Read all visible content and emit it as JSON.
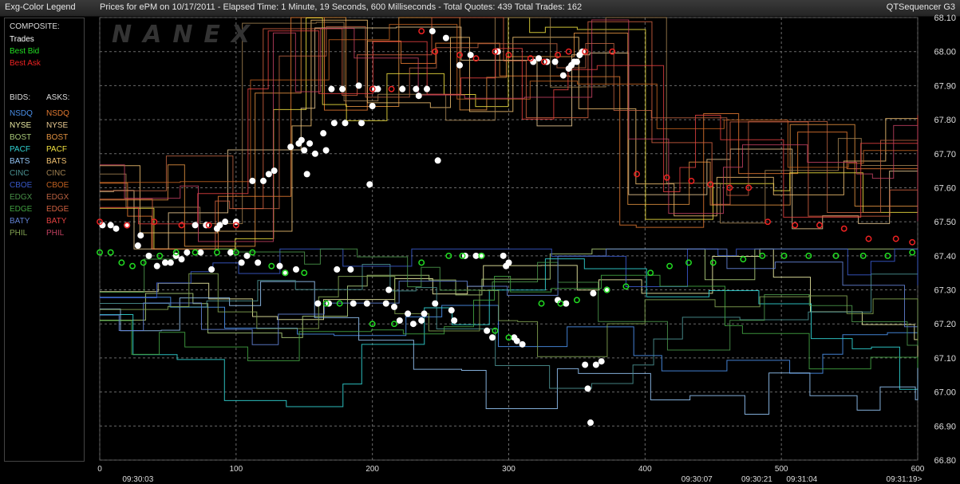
{
  "window": {
    "legend_title": "Exg-Color Legend",
    "chart_title": "Prices for  ePM  on  10/17/2011   -  Elapsed Time: 1 Minute, 19 Seconds, 600 Milliseconds   -  Total Quotes: 439  Total Trades: 162",
    "app_name": "QTSequencer G3"
  },
  "watermark": "NANEX",
  "legend": {
    "composite_header": "COMPOSITE:",
    "composite": [
      {
        "label": "Trades",
        "color": "#ffffff"
      },
      {
        "label": "Best Bid",
        "color": "#22dd22"
      },
      {
        "label": "Best Ask",
        "color": "#ee2222"
      }
    ],
    "bids_header": "BIDS:",
    "asks_header": "ASKS:",
    "exchanges": [
      {
        "name": "NSDQ",
        "bid_color": "#4a8fe8",
        "ask_color": "#e07830"
      },
      {
        "name": "NYSE",
        "bid_color": "#e8e8a0",
        "ask_color": "#e8c890"
      },
      {
        "name": "BOST",
        "bid_color": "#a8c878",
        "ask_color": "#e09040"
      },
      {
        "name": "PACF",
        "bid_color": "#30d0d0",
        "ask_color": "#f0e040"
      },
      {
        "name": "BATS",
        "bid_color": "#90c0f0",
        "ask_color": "#f0c070"
      },
      {
        "name": "CINC",
        "bid_color": "#4a9090",
        "ask_color": "#a08050"
      },
      {
        "name": "CBOE",
        "bid_color": "#3858c8",
        "ask_color": "#c06020"
      },
      {
        "name": "EDGX",
        "bid_color": "#489048",
        "ask_color": "#b86040"
      },
      {
        "name": "EDGE",
        "bid_color": "#40a040",
        "ask_color": "#d06040"
      },
      {
        "name": "BATY",
        "bid_color": "#6080d0",
        "ask_color": "#e04040"
      },
      {
        "name": "PHIL",
        "bid_color": "#80a050",
        "ask_color": "#c04060"
      }
    ]
  },
  "chart_data": {
    "type": "scatter",
    "title": "Prices for  ePM  on  10/17/2011",
    "x_range": [
      0,
      600
    ],
    "y_range": [
      66.8,
      68.1
    ],
    "x_ticks": [
      0,
      100,
      200,
      300,
      400,
      500,
      600
    ],
    "y_ticks": [
      "68.10",
      "68.00",
      "67.90",
      "67.80",
      "67.70",
      "67.60",
      "67.50",
      "67.40",
      "67.30",
      "67.20",
      "67.10",
      "67.00",
      "66.90",
      "66.80"
    ],
    "time_labels": [
      {
        "x": 28,
        "label": "09:30:03"
      },
      {
        "x": 438,
        "label": "09:30:07"
      },
      {
        "x": 482,
        "label": "09:30:21"
      },
      {
        "x": 515,
        "label": "09:31:04"
      },
      {
        "x": 590,
        "label": "09:31:19>"
      }
    ],
    "grid": true,
    "series": [
      {
        "name": "Trades",
        "color": "#ffffff",
        "marker": "dot",
        "points": [
          [
            2,
            67.49
          ],
          [
            8,
            67.49
          ],
          [
            12,
            67.48
          ],
          [
            20,
            67.49
          ],
          [
            28,
            67.43
          ],
          [
            30,
            67.46
          ],
          [
            36,
            67.4
          ],
          [
            42,
            67.37
          ],
          [
            48,
            67.38
          ],
          [
            52,
            67.38
          ],
          [
            56,
            67.4
          ],
          [
            60,
            67.39
          ],
          [
            64,
            67.41
          ],
          [
            70,
            67.49
          ],
          [
            74,
            67.41
          ],
          [
            78,
            67.49
          ],
          [
            82,
            67.36
          ],
          [
            86,
            67.48
          ],
          [
            88,
            67.49
          ],
          [
            92,
            67.5
          ],
          [
            96,
            67.41
          ],
          [
            100,
            67.5
          ],
          [
            104,
            67.38
          ],
          [
            108,
            67.4
          ],
          [
            112,
            67.62
          ],
          [
            116,
            67.38
          ],
          [
            120,
            67.62
          ],
          [
            124,
            67.64
          ],
          [
            128,
            67.65
          ],
          [
            132,
            67.37
          ],
          [
            136,
            67.35
          ],
          [
            140,
            67.72
          ],
          [
            144,
            67.36
          ],
          [
            146,
            67.73
          ],
          [
            148,
            67.74
          ],
          [
            150,
            67.71
          ],
          [
            152,
            67.64
          ],
          [
            154,
            67.73
          ],
          [
            158,
            67.7
          ],
          [
            160,
            67.26
          ],
          [
            164,
            67.76
          ],
          [
            166,
            67.71
          ],
          [
            168,
            67.26
          ],
          [
            170,
            67.89
          ],
          [
            172,
            67.79
          ],
          [
            174,
            67.36
          ],
          [
            178,
            67.89
          ],
          [
            180,
            67.79
          ],
          [
            184,
            67.36
          ],
          [
            186,
            67.26
          ],
          [
            190,
            67.9
          ],
          [
            192,
            67.79
          ],
          [
            196,
            67.26
          ],
          [
            198,
            67.61
          ],
          [
            200,
            67.84
          ],
          [
            202,
            67.89
          ],
          [
            204,
            67.89
          ],
          [
            210,
            67.26
          ],
          [
            212,
            67.3
          ],
          [
            216,
            67.25
          ],
          [
            220,
            67.21
          ],
          [
            222,
            67.89
          ],
          [
            226,
            67.23
          ],
          [
            230,
            67.2
          ],
          [
            232,
            67.89
          ],
          [
            234,
            67.87
          ],
          [
            236,
            67.21
          ],
          [
            238,
            67.23
          ],
          [
            240,
            67.89
          ],
          [
            244,
            68.06
          ],
          [
            246,
            67.26
          ],
          [
            248,
            67.68
          ],
          [
            254,
            68.04
          ],
          [
            258,
            67.24
          ],
          [
            260,
            67.21
          ],
          [
            264,
            67.96
          ],
          [
            268,
            67.4
          ],
          [
            272,
            67.99
          ],
          [
            276,
            67.4
          ],
          [
            280,
            67.4
          ],
          [
            284,
            67.18
          ],
          [
            288,
            67.16
          ],
          [
            292,
            68.0
          ],
          [
            296,
            67.4
          ],
          [
            298,
            67.37
          ],
          [
            300,
            67.38
          ],
          [
            304,
            67.16
          ],
          [
            306,
            67.15
          ],
          [
            310,
            67.14
          ],
          [
            318,
            67.97
          ],
          [
            322,
            67.98
          ],
          [
            328,
            67.97
          ],
          [
            334,
            67.97
          ],
          [
            336,
            67.27
          ],
          [
            340,
            67.93
          ],
          [
            342,
            67.26
          ],
          [
            344,
            67.95
          ],
          [
            346,
            67.96
          ],
          [
            348,
            67.97
          ],
          [
            350,
            67.97
          ],
          [
            352,
            67.99
          ],
          [
            354,
            68.0
          ],
          [
            356,
            67.08
          ],
          [
            358,
            67.01
          ],
          [
            360,
            66.91
          ],
          [
            362,
            67.29
          ],
          [
            364,
            67.08
          ],
          [
            368,
            67.09
          ],
          [
            372,
            67.3
          ]
        ]
      },
      {
        "name": "Best Bid",
        "color": "#22dd22",
        "marker": "ring",
        "points": [
          [
            0,
            67.41
          ],
          [
            8,
            67.41
          ],
          [
            16,
            67.38
          ],
          [
            24,
            67.37
          ],
          [
            32,
            67.38
          ],
          [
            44,
            67.4
          ],
          [
            56,
            67.41
          ],
          [
            70,
            67.41
          ],
          [
            86,
            67.41
          ],
          [
            100,
            67.41
          ],
          [
            112,
            67.41
          ],
          [
            126,
            67.37
          ],
          [
            136,
            67.35
          ],
          [
            150,
            67.35
          ],
          [
            166,
            67.26
          ],
          [
            176,
            67.26
          ],
          [
            200,
            67.2
          ],
          [
            216,
            67.2
          ],
          [
            236,
            67.38
          ],
          [
            256,
            67.4
          ],
          [
            266,
            67.4
          ],
          [
            280,
            67.4
          ],
          [
            290,
            67.18
          ],
          [
            300,
            67.16
          ],
          [
            324,
            67.26
          ],
          [
            338,
            67.26
          ],
          [
            350,
            67.27
          ],
          [
            372,
            67.3
          ],
          [
            386,
            67.31
          ],
          [
            404,
            67.35
          ],
          [
            418,
            67.37
          ],
          [
            432,
            67.38
          ],
          [
            450,
            67.38
          ],
          [
            472,
            67.39
          ],
          [
            486,
            67.4
          ],
          [
            502,
            67.4
          ],
          [
            520,
            67.4
          ],
          [
            540,
            67.4
          ],
          [
            560,
            67.4
          ],
          [
            578,
            67.4
          ],
          [
            596,
            67.41
          ]
        ]
      },
      {
        "name": "Best Ask",
        "color": "#ee2222",
        "marker": "ring",
        "points": [
          [
            0,
            67.5
          ],
          [
            20,
            67.49
          ],
          [
            40,
            67.5
          ],
          [
            60,
            67.49
          ],
          [
            80,
            67.49
          ],
          [
            100,
            67.49
          ],
          [
            200,
            67.89
          ],
          [
            214,
            67.89
          ],
          [
            236,
            68.06
          ],
          [
            246,
            68.0
          ],
          [
            264,
            67.99
          ],
          [
            276,
            67.98
          ],
          [
            290,
            68.0
          ],
          [
            300,
            67.99
          ],
          [
            316,
            67.98
          ],
          [
            326,
            67.97
          ],
          [
            336,
            67.99
          ],
          [
            344,
            68.0
          ],
          [
            356,
            68.0
          ],
          [
            376,
            68.0
          ],
          [
            394,
            67.64
          ],
          [
            416,
            67.63
          ],
          [
            434,
            67.62
          ],
          [
            448,
            67.61
          ],
          [
            462,
            67.6
          ],
          [
            476,
            67.6
          ],
          [
            490,
            67.5
          ],
          [
            510,
            67.49
          ],
          [
            528,
            67.49
          ],
          [
            546,
            67.48
          ],
          [
            564,
            67.45
          ],
          [
            584,
            67.45
          ],
          [
            596,
            67.44
          ]
        ]
      }
    ]
  }
}
